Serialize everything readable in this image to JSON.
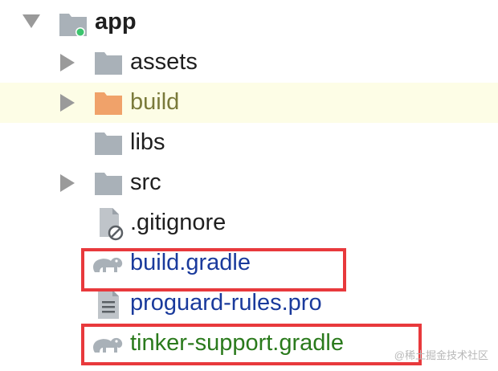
{
  "tree": {
    "root": {
      "label": "app",
      "icon": "module-folder-icon",
      "expanded": true
    },
    "items": [
      {
        "label": "assets",
        "icon": "folder-icon",
        "has_arrow": true
      },
      {
        "label": "build",
        "icon": "excluded-folder-icon",
        "has_arrow": true
      },
      {
        "label": "libs",
        "icon": "folder-icon",
        "has_arrow": false
      },
      {
        "label": "src",
        "icon": "folder-icon",
        "has_arrow": true
      },
      {
        "label": ".gitignore",
        "icon": "ignored-file-icon",
        "has_arrow": false
      },
      {
        "label": "build.gradle",
        "icon": "gradle-elephant-icon",
        "has_arrow": false
      },
      {
        "label": "proguard-rules.pro",
        "icon": "text-file-icon",
        "has_arrow": false
      },
      {
        "label": "tinker-support.gradle",
        "icon": "gradle-elephant-icon",
        "has_arrow": false
      }
    ]
  },
  "colors": {
    "folder": "#a9b1b8",
    "excluded_folder": "#f0a26a",
    "module_dot": "#3cc46e",
    "highlight_row": "#fdfde6",
    "annotation_box": "#e8393c",
    "label_default": "#1f1f1f",
    "label_olive": "#7a7a3a",
    "label_blue": "#1a3a9c",
    "label_green": "#2a7a1c"
  },
  "watermark": "@稀土掘金技术社区"
}
